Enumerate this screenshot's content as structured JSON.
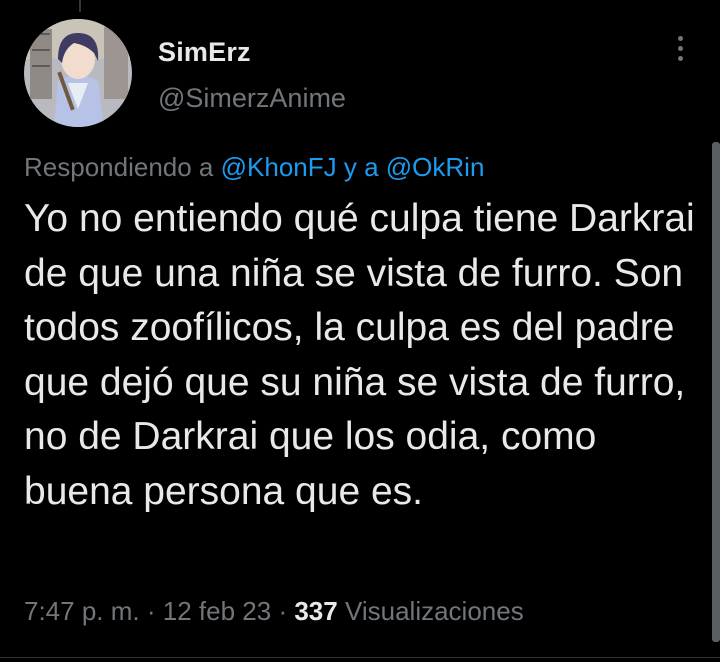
{
  "author": {
    "display_name": "SimErz",
    "handle": "@SimerzAnime"
  },
  "reply": {
    "prefix": "Respondiendo a",
    "mention_1": "@KhonFJ",
    "connector": "y a",
    "mention_2": "@OkRin"
  },
  "tweet": {
    "text": "Yo no entiendo qué culpa tiene Darkrai de que una niña se vista de furro. Son todos zoofílicos, la culpa es del padre que dejó que su niña se vista de furro, no de Darkrai que los odia, como buena persona que es."
  },
  "meta": {
    "time": "7:47 p. m.",
    "separator": "·",
    "date": "12 feb 23",
    "views_count": "337",
    "views_label": "Visualizaciones"
  },
  "icons": {
    "more": "more-vertical-icon"
  },
  "colors": {
    "background": "#000000",
    "text_primary": "#e7e9ea",
    "text_secondary": "#71767b",
    "link": "#1d9bf0"
  }
}
